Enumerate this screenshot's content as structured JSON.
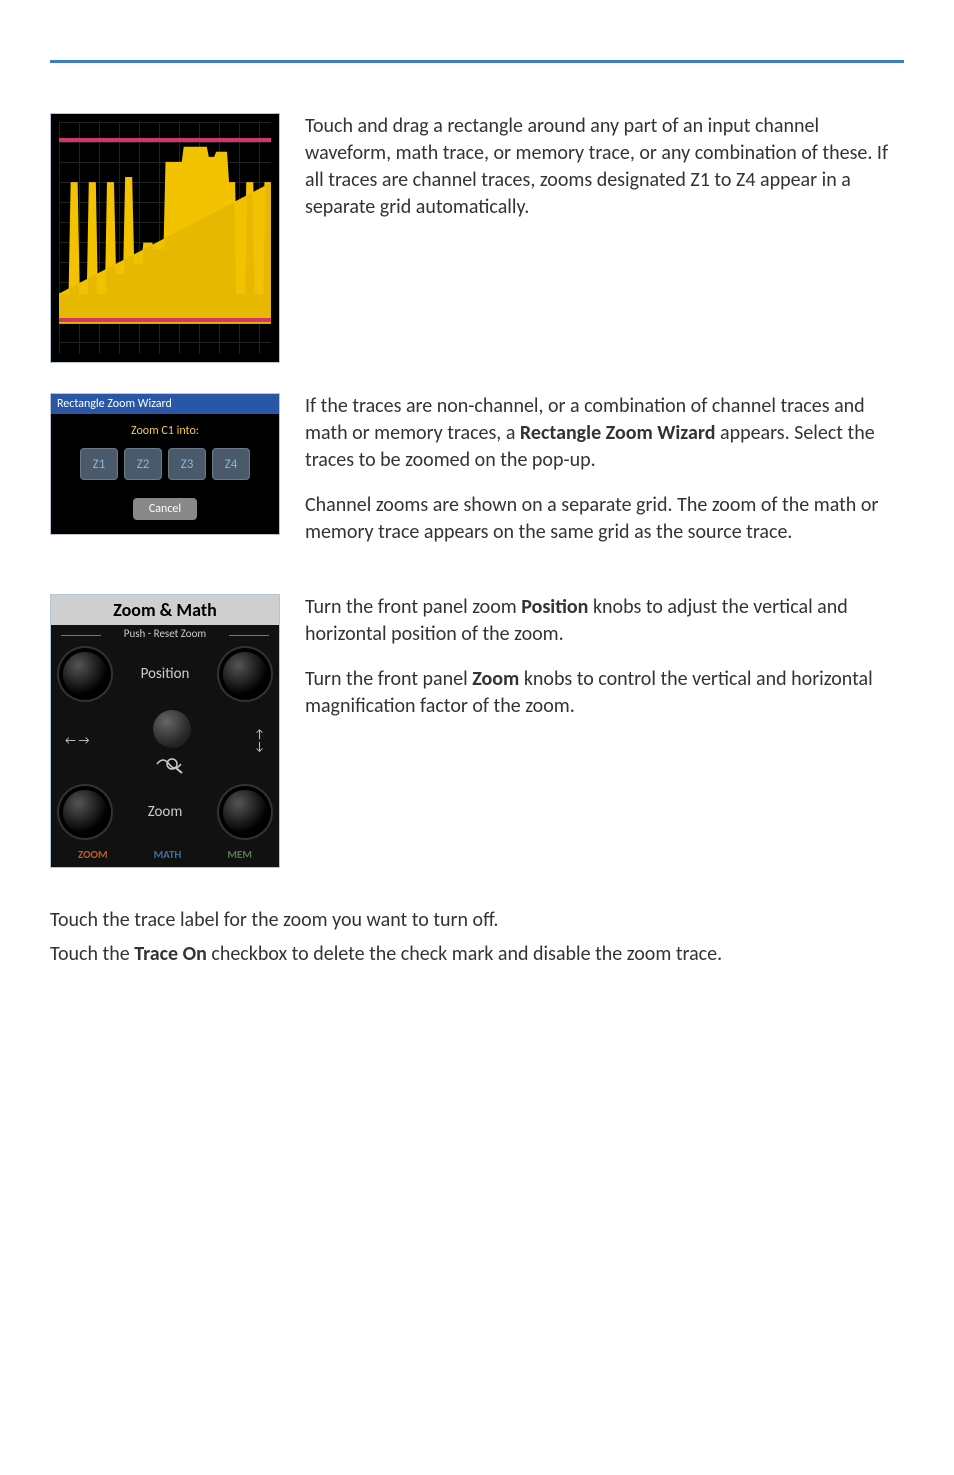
{
  "row1": {
    "para1": "Touch and drag a rectangle around any part of an input channel waveform, math trace, or memory trace, or any combination of these. If all traces are channel traces, zooms designated Z1 to Z4 appear in a separate grid automatically."
  },
  "row2": {
    "dialog": {
      "title": "Rectangle Zoom Wizard",
      "subtitle": "Zoom C1 into:",
      "buttons": [
        "Z1",
        "Z2",
        "Z3",
        "Z4"
      ],
      "cancel": "Cancel"
    },
    "para1_pre": "If the traces are non-channel, or a combination of channel traces and math or memory traces, a ",
    "para1_bold": "Rectangle Zoom Wizard",
    "para1_post": " appears. Select the traces to be zoomed on the pop-up.",
    "para2": "Channel zooms are shown on a separate grid. The zoom of the math or memory trace appears on the same grid as the source trace."
  },
  "row3": {
    "panel": {
      "header": "Zoom & Math",
      "sub": "Push - Reset Zoom",
      "pos_label": "Position",
      "zoom_label": "Zoom",
      "tab_zoom": "ZOOM",
      "tab_math": "MATH",
      "tab_mem": "MEM"
    },
    "para1_pre": "Turn the front panel zoom ",
    "para1_bold": "Position",
    "para1_post": " knobs to adjust the vertical and horizontal position of the zoom.",
    "para2_pre": "Turn the front panel ",
    "para2_bold": "Zoom",
    "para2_post": " knobs to control the vertical and horizontal magnification factor of the zoom."
  },
  "bottom": {
    "para1": "Touch the trace label for the zoom you want to turn off.",
    "para2_pre": "Touch the ",
    "para2_bold": "Trace On",
    "para2_post": " checkbox to delete the check mark and disable the zoom trace."
  }
}
